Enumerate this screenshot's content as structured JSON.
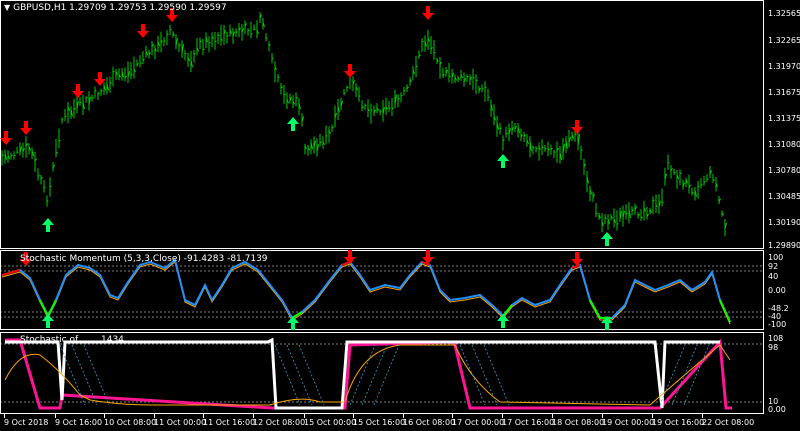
{
  "header": {
    "symbol_line": "GBPUSD,H1  1.29709 1.29753 1.29590 1.29597"
  },
  "indicator1": {
    "title": "Stochastic Momentum (5,3,3,Close) -91.4283 -81.7139",
    "levels": [
      "100",
      "92",
      "40",
      "0.00",
      "-40",
      "-48.2",
      "-100"
    ]
  },
  "indicator2": {
    "title": "Stochastic of ...... 1434",
    "levels": [
      "108",
      "98",
      "10",
      "0.00"
    ]
  },
  "price_axis": [
    "1.32565",
    "1.32265",
    "1.31970",
    "1.31675",
    "1.31375",
    "1.31080",
    "1.30780",
    "1.30485",
    "1.30190",
    "1.29890"
  ],
  "time_axis": [
    "9 Oct 2018",
    "9 Oct 16:00",
    "10 Oct 08:00",
    "11 Oct 00:00",
    "11 Oct 16:00",
    "12 Oct 08:00",
    "15 Oct 00:00",
    "15 Oct 16:00",
    "16 Oct 08:00",
    "17 Oct 00:00",
    "17 Oct 16:00",
    "18 Oct 08:00",
    "19 Oct 00:00",
    "19 Oct 16:00",
    "22 Oct 08:00"
  ],
  "colors": {
    "bars": "#00cc00",
    "sell_arrow": "#ff0000",
    "buy_arrow": "#00ff66",
    "stoch_main": "#1e90ff",
    "stoch_signal": "#ffa500",
    "stoch_low": "#00ff00",
    "stoch_high": "#ff0000",
    "line_white": "#ffffff",
    "line_pink": "#ff1493",
    "grid": "#ffffff"
  },
  "chart_data": {
    "type": "candlestick",
    "arrows_sell": [
      "9 Oct 00:00",
      "9 Oct 06:00",
      "10 Oct 00:00",
      "10 Oct 04:00",
      "10 Oct 16:00",
      "11 Oct 00:00",
      "15 Oct 04:00",
      "16 Oct 10:00",
      "18 Oct 10:00"
    ],
    "arrows_buy": [
      "9 Oct 16:00",
      "12 Oct 18:00",
      "17 Oct 14:00",
      "19 Oct 00:00"
    ]
  }
}
